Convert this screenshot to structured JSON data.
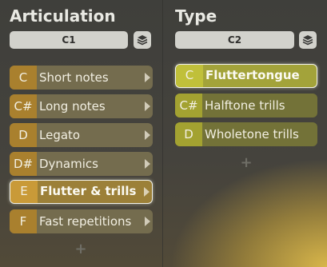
{
  "articulation": {
    "title": "Articulation",
    "selector": "C1",
    "items": [
      {
        "key": "C",
        "label": "Short notes"
      },
      {
        "key": "C#",
        "label": "Long notes"
      },
      {
        "key": "D",
        "label": "Legato"
      },
      {
        "key": "D#",
        "label": "Dynamics"
      },
      {
        "key": "E",
        "label": "Flutter & trills",
        "selected": true
      },
      {
        "key": "F",
        "label": "Fast repetitions"
      }
    ],
    "add_label": "+"
  },
  "type": {
    "title": "Type",
    "selector": "C2",
    "items": [
      {
        "key": "C",
        "label": "Fluttertongue",
        "selected": true
      },
      {
        "key": "C#",
        "label": "Halftone trills"
      },
      {
        "key": "D",
        "label": "Wholetone trills"
      }
    ],
    "add_label": "+"
  },
  "icons": {
    "stack": "layers-stack-icon",
    "arrow": "chevron-right-icon",
    "add": "plus-icon"
  }
}
